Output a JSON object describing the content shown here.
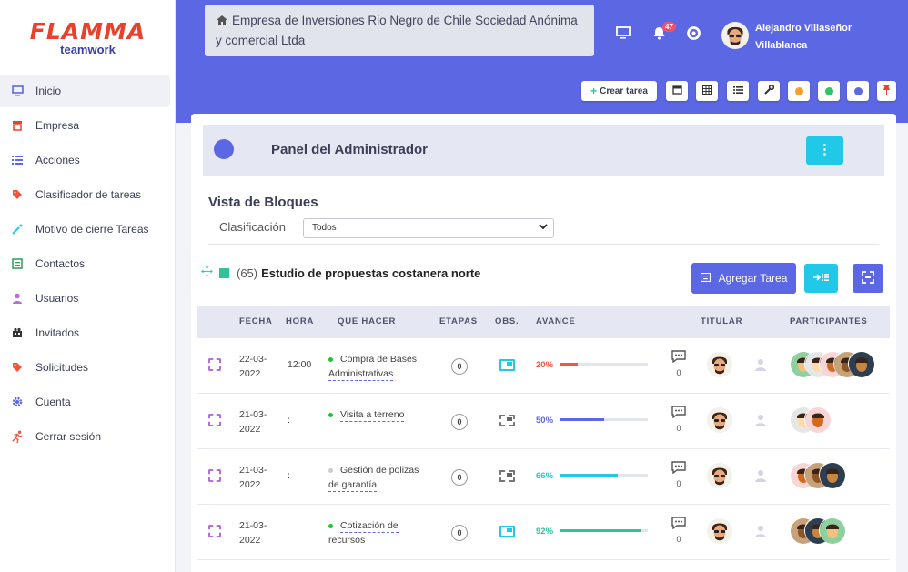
{
  "brand": {
    "logo_text_a": "FLAMMA",
    "logo_text_b": "teamwork"
  },
  "sidebar": {
    "items": [
      {
        "label": "Inicio",
        "icon": "monitor-icon",
        "color": "#5c67e4",
        "active": true
      },
      {
        "label": "Empresa",
        "icon": "store-icon",
        "color": "#e8412d",
        "active": false
      },
      {
        "label": "Acciones",
        "icon": "list-icon",
        "color": "#5c67e4",
        "active": false
      },
      {
        "label": "Clasificador de tareas",
        "icon": "tag-icon",
        "color": "#f2553d",
        "active": false
      },
      {
        "label": "Motivo de cierre Tareas",
        "icon": "wand-icon",
        "color": "#21c8e8",
        "active": false
      },
      {
        "label": "Contactos",
        "icon": "address-card-icon",
        "color": "#2e9c5a",
        "active": false
      },
      {
        "label": "Usuarios",
        "icon": "user-icon",
        "color": "#b66edb",
        "active": false
      },
      {
        "label": "Invitados",
        "icon": "group-icon",
        "color": "#333333",
        "active": false
      },
      {
        "label": "Solicitudes",
        "icon": "tag-icon",
        "color": "#f2553d",
        "active": false
      },
      {
        "label": "Cuenta",
        "icon": "gear-icon",
        "color": "#5c67e4",
        "active": false
      },
      {
        "label": "Cerrar sesión",
        "icon": "running-icon",
        "color": "#f2553d",
        "active": false
      }
    ]
  },
  "header": {
    "org_name": "Empresa de Inversiones Rio Negro de Chile Sociedad Anónima y comercial Ltda",
    "notifications_count": "47",
    "user_name": "Alejandro Villaseñor Villablanca"
  },
  "toolbar": {
    "create_task_label": "Crear tarea"
  },
  "panel": {
    "title": "Panel del Administrador"
  },
  "view": {
    "title": "Vista de Bloques",
    "classification_label": "Clasificación",
    "classification_value": "Todos"
  },
  "project": {
    "count": "(65)",
    "name": "Estudio de propuestas costanera norte",
    "add_task_label": "Agregar Tarea"
  },
  "table": {
    "headers": {
      "fecha": "FECHA",
      "hora": "HORA",
      "que_hacer": "QUE HACER",
      "etapas": "ETAPAS",
      "obs": "OBS.",
      "avance": "AVANCE",
      "titular": "TITULAR",
      "participantes": "PARTICIPANTES"
    },
    "rows": [
      {
        "date_line1": "22-03-",
        "date_line2": "2022",
        "hora": "12:00",
        "task_line1": "Compra de Bases",
        "task_line2": "Administrativas",
        "dot": "green",
        "etapas": "0",
        "obs": "on",
        "avance": "20%",
        "avance_value": 0.2,
        "avance_color": "#f2553d",
        "comments": "0",
        "participants": 5
      },
      {
        "date_line1": "21-03-",
        "date_line2": "2022",
        "hora": ":",
        "task_line1": "Visita a terreno",
        "task_line2": "",
        "dot": "green",
        "etapas": "0",
        "obs": "off",
        "avance": "50%",
        "avance_value": 0.5,
        "avance_color": "#5c67e4",
        "comments": "0",
        "participants": 2
      },
      {
        "date_line1": "21-03-",
        "date_line2": "2022",
        "hora": ":",
        "task_line1": "Gestión de polizas",
        "task_line2": "de garantía",
        "dot": "gray",
        "etapas": "0",
        "obs": "off",
        "avance": "66%",
        "avance_value": 0.66,
        "avance_color": "#21c8e8",
        "comments": "0",
        "participants": 3
      },
      {
        "date_line1": "21-03-",
        "date_line2": "2022",
        "hora": "",
        "task_line1": "Cotización de",
        "task_line2": "recursos",
        "dot": "green",
        "etapas": "0",
        "obs": "on",
        "avance": "92%",
        "avance_value": 0.92,
        "avance_color": "#2ec497",
        "comments": "0",
        "participants": 3
      }
    ]
  }
}
